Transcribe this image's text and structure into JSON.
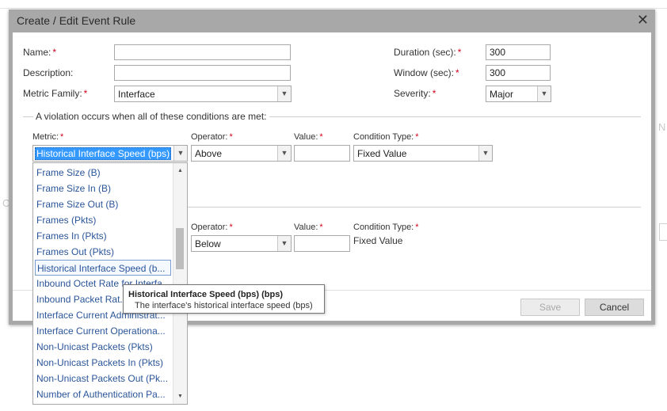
{
  "dialog": {
    "title": "Create / Edit Event Rule",
    "close_glyph": "✕"
  },
  "background": {
    "fragment_n": "N",
    "fragment_c": "C"
  },
  "form": {
    "name": {
      "label": "Name:",
      "value": ""
    },
    "description": {
      "label": "Description:",
      "value": ""
    },
    "metric_family": {
      "label": "Metric Family:",
      "value": "Interface"
    },
    "duration": {
      "label": "Duration (sec):",
      "value": "300"
    },
    "window": {
      "label": "Window (sec):",
      "value": "300"
    },
    "severity": {
      "label": "Severity:",
      "value": "Major"
    },
    "required_mark": "*"
  },
  "conditions": {
    "legend": "A violation occurs when all of these conditions are met:",
    "row1": {
      "metric_label": "Metric:",
      "metric_value": "Historical Interface Speed (bps)",
      "operator_label": "Operator:",
      "operator_value": "Above",
      "value_label": "Value:",
      "value": "",
      "condition_type_label": "Condition Type:",
      "condition_type_value": "Fixed Value"
    },
    "row2": {
      "operator_label": "Operator:",
      "operator_value": "Below",
      "value_label": "Value:",
      "value": "",
      "condition_type_label": "Condition Type:",
      "condition_type_value": "Fixed Value"
    }
  },
  "metric_dropdown": {
    "items": [
      "Frame Size (B)",
      "Frame Size In (B)",
      "Frame Size Out (B)",
      "Frames (Pkts)",
      "Frames In (Pkts)",
      "Frames Out (Pkts)",
      "Historical Interface Speed (b...",
      "Inbound Octet Rate for Interfa...",
      "Inbound Packet Rat...",
      "Interface Current Administrat...",
      "Interface Current Operationa...",
      "Non-Unicast Packets (Pkts)",
      "Non-Unicast Packets In (Pkts)",
      "Non-Unicast Packets Out (Pk...",
      "Number of Authentication Pa..."
    ],
    "selected_index": 6
  },
  "tooltip": {
    "title": "Historical Interface Speed (bps) (bps)",
    "description": "The interface's historical interface speed (bps)"
  },
  "buttons": {
    "save": "Save",
    "cancel": "Cancel"
  },
  "icons": {
    "dropdown_arrow": "chevron-down-icon",
    "close": "close-icon"
  }
}
